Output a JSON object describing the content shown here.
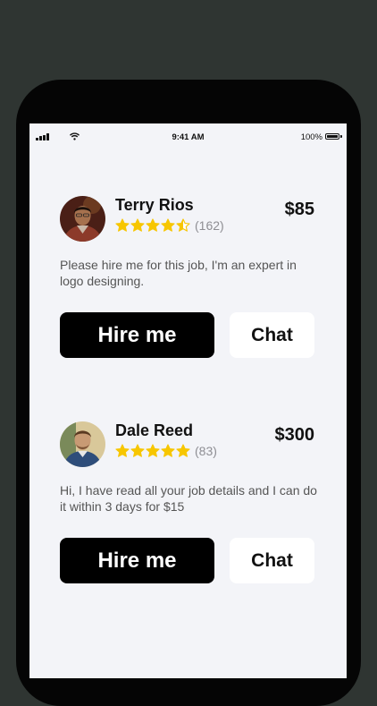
{
  "status_bar": {
    "time": "9:41 AM",
    "battery": "100%"
  },
  "colors": {
    "star": "#f7c600",
    "star_empty": "#d8d8d8",
    "button_dark": "#000000",
    "button_light": "#ffffff",
    "background": "#f3f4f8"
  },
  "bids": [
    {
      "name": "Terry Rios",
      "rating": 4.5,
      "review_count": "(162)",
      "price": "$85",
      "message": "Please hire me for this job, I'm an expert in logo designing.",
      "hire_label": "Hire me",
      "chat_label": "Chat",
      "avatar_icon": "avatar-photo"
    },
    {
      "name": "Dale Reed",
      "rating": 5,
      "review_count": "(83)",
      "price": "$300",
      "message": "Hi, I have read all your job details and I can do it within 3 days for $15",
      "hire_label": "Hire me",
      "chat_label": "Chat",
      "avatar_icon": "avatar-photo"
    }
  ]
}
